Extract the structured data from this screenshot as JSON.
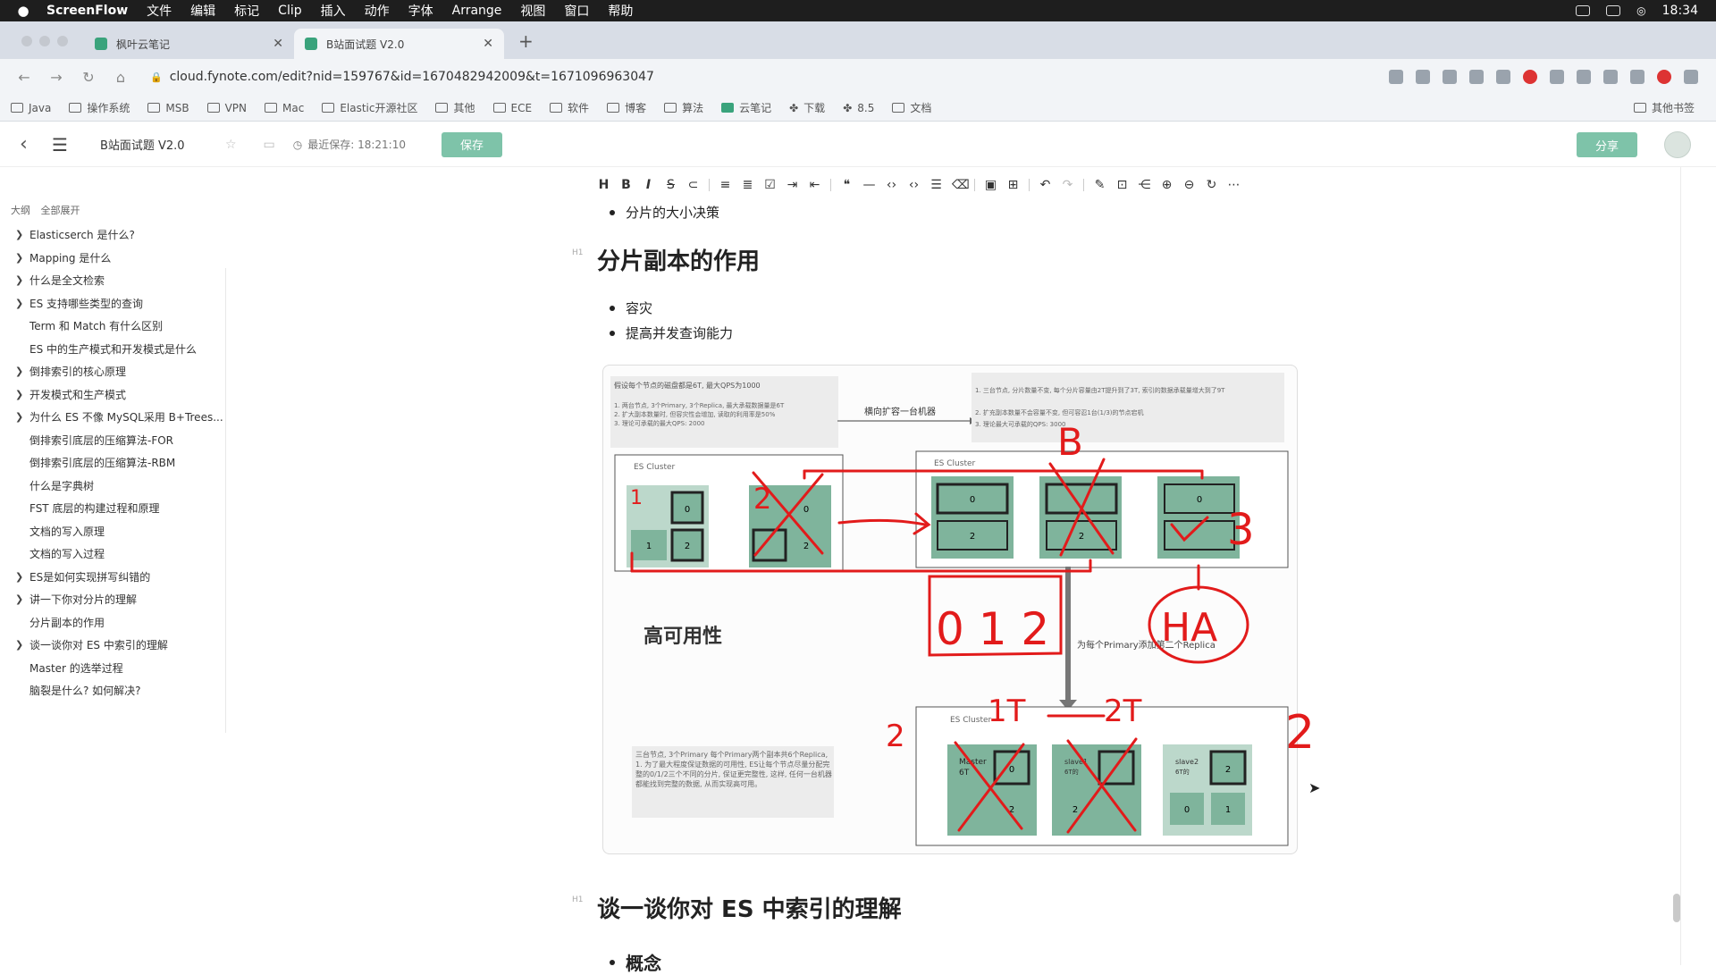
{
  "menubar": {
    "apple": "",
    "items": [
      "ScreenFlow",
      "文件",
      "编辑",
      "标记",
      "Clip",
      "插入",
      "动作",
      "字体",
      "Arrange",
      "视图",
      "窗口",
      "帮助"
    ],
    "clock": "18:34"
  },
  "tabs": [
    {
      "label": "枫叶云笔记"
    },
    {
      "label": "B站面试题 V2.0"
    }
  ],
  "address": {
    "url": "cloud.fynote.com/edit?nid=159767&id=1670482942009&t=1671096963047"
  },
  "bookmarks": {
    "items": [
      "Java",
      "操作系统",
      "MSB",
      "VPN",
      "Mac",
      "Elastic开源社区",
      "其他",
      "ECE",
      "软件",
      "博客",
      "算法",
      "云笔记",
      "下载",
      "8.5",
      "文档"
    ],
    "other": "其他书签"
  },
  "app": {
    "title": "B站面试题 V2.0",
    "saved_text": "最近保存: 18:21:10",
    "save_label": "保存",
    "share_label": "分享"
  },
  "outline": {
    "head_a": "大纲",
    "head_b": "全部展开",
    "items": [
      {
        "label": "Elasticserch 是什么?",
        "chev": true
      },
      {
        "label": "Mapping 是什么",
        "chev": true
      },
      {
        "label": "什么是全文检索",
        "chev": true
      },
      {
        "label": "ES 支持哪些类型的查询",
        "chev": true
      },
      {
        "label": "Term 和 Match 有什么区别",
        "chev": false
      },
      {
        "label": "ES 中的生产模式和开发模式是什么",
        "chev": false
      },
      {
        "label": "倒排索引的核心原理",
        "chev": true
      },
      {
        "label": "开发模式和生产模式",
        "chev": true
      },
      {
        "label": "为什么 ES 不像 MySQL采用 B+Trees...",
        "chev": true
      },
      {
        "label": "倒排索引底层的压缩算法-FOR",
        "chev": false
      },
      {
        "label": "倒排索引底层的压缩算法-RBM",
        "chev": false
      },
      {
        "label": "什么是字典树",
        "chev": false
      },
      {
        "label": "FST 底层的构建过程和原理",
        "chev": false
      },
      {
        "label": "文档的写入原理",
        "chev": false
      },
      {
        "label": "文档的写入过程",
        "chev": false
      },
      {
        "label": "ES是如何实现拼写纠错的",
        "chev": true
      },
      {
        "label": "讲一下你对分片的理解",
        "chev": true
      },
      {
        "label": "分片副本的作用",
        "chev": false
      },
      {
        "label": "谈一谈你对 ES 中索引的理解",
        "chev": true
      },
      {
        "label": "Master 的选举过程",
        "chev": false
      },
      {
        "label": "脑裂是什么? 如何解决?",
        "chev": false
      }
    ]
  },
  "doc": {
    "top_bullet": "分片的大小决策",
    "section_title": "分片副本的作用",
    "bullets": [
      "容灾",
      "提高并发查询能力"
    ],
    "next_title": "谈一谈你对 ES 中索引的理解",
    "next_sub": "概念"
  },
  "diagram": {
    "note_left_title": "假设每个节点的磁盘都是6T, 最大QPS为1000",
    "note_left_lines": [
      "1. 两台节点, 3个Primary, 3个Replica, 最大承载数据量是6T",
      "2. 扩大副本数量时, 但容灾性会增加, 读取的利用率是50%",
      "3. 理论可承载的最大QPS: 2000"
    ],
    "arrow_label": "横向扩容一台机器",
    "note_right_lines": [
      "1. 三台节点, 分片数量不变, 每个分片容量由2T提升到了3T, 索引的数据承载量增大到了9T",
      "2. 扩充副本数量不会容量不变, 但可容忍1台(1/3)的节点宕机",
      "3. 理论最大可承载的QPS: 3000"
    ],
    "cluster_label": "ES Cluster",
    "shard_0": "0",
    "shard_1": "1",
    "shard_2": "2",
    "ha_label": "高可用性",
    "replica_note": "为每个Primary添加第二个Replica",
    "note_bottom": "三台节点, 3个Primary 每个Primary两个副本共6个Replica, 1. 为了最大程度保证数据的可用性, ES让每个节点尽量分配完整的0/1/2三个不同的分片, 保证更完整性, 这样, 任何一台机器都能找到完整的数据, 从而实现高可用。",
    "node_master": "Master",
    "node_slave1": "slave1",
    "node_slave2": "slave2",
    "node_size": "6T",
    "size_small": "6T的",
    "hand_1": "1",
    "hand_2": "2",
    "hand_3": "3",
    "hand_b": "B",
    "hand_012": "0 1 2",
    "hand_ha": "HA",
    "hand_1t": "1T",
    "hand_2t": "2T",
    "hand_2a": "2",
    "hand_2b": "2",
    "colors": {
      "shard_bg": "#7fb49c",
      "node_bg": "#bcd8cb",
      "red": "#e21b1b"
    }
  }
}
